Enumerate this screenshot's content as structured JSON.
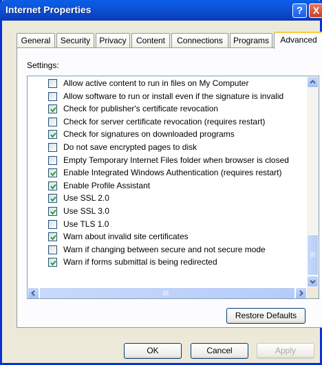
{
  "window": {
    "title": "Internet Properties",
    "help_label": "?",
    "close_label": "X"
  },
  "tabs": [
    {
      "label": "General"
    },
    {
      "label": "Security"
    },
    {
      "label": "Privacy"
    },
    {
      "label": "Content"
    },
    {
      "label": "Connections"
    },
    {
      "label": "Programs"
    },
    {
      "label": "Advanced",
      "active": true
    }
  ],
  "settings": {
    "label": "Settings:",
    "items": [
      {
        "label": "Allow active content to run in files on My Computer",
        "checked": false
      },
      {
        "label": "Allow software to run or install even if the signature is invalid",
        "checked": false
      },
      {
        "label": "Check for publisher's certificate revocation",
        "checked": true
      },
      {
        "label": "Check for server certificate revocation (requires restart)",
        "checked": false
      },
      {
        "label": "Check for signatures on downloaded programs",
        "checked": true
      },
      {
        "label": "Do not save encrypted pages to disk",
        "checked": false
      },
      {
        "label": "Empty Temporary Internet Files folder when browser is closed",
        "checked": false
      },
      {
        "label": "Enable Integrated Windows Authentication (requires restart)",
        "checked": true
      },
      {
        "label": "Enable Profile Assistant",
        "checked": true
      },
      {
        "label": "Use SSL 2.0",
        "checked": true
      },
      {
        "label": "Use SSL 3.0",
        "checked": true
      },
      {
        "label": "Use TLS 1.0",
        "checked": false
      },
      {
        "label": "Warn about invalid site certificates",
        "checked": true
      },
      {
        "label": "Warn if changing between secure and not secure mode",
        "checked": false
      },
      {
        "label": "Warn if forms submittal is being redirected",
        "checked": true
      }
    ],
    "scroll": {
      "vertical_position": 1.0,
      "horizontal_position": 0.45
    }
  },
  "buttons": {
    "restore_defaults": "Restore Defaults",
    "ok": "OK",
    "cancel": "Cancel",
    "apply": "Apply"
  },
  "icons": {
    "help": "question-mark-icon",
    "close": "close-x-icon",
    "checkmark": "checkmark-icon",
    "scroll_up": "arrow-up-icon",
    "scroll_down": "arrow-down-icon",
    "scroll_left": "arrow-left-icon",
    "scroll_right": "arrow-right-icon"
  },
  "colors": {
    "title_bar": "#0a5fe8",
    "close": "#c6412a",
    "accent_tab": "#ffc83c",
    "checkmark": "#21a121"
  }
}
